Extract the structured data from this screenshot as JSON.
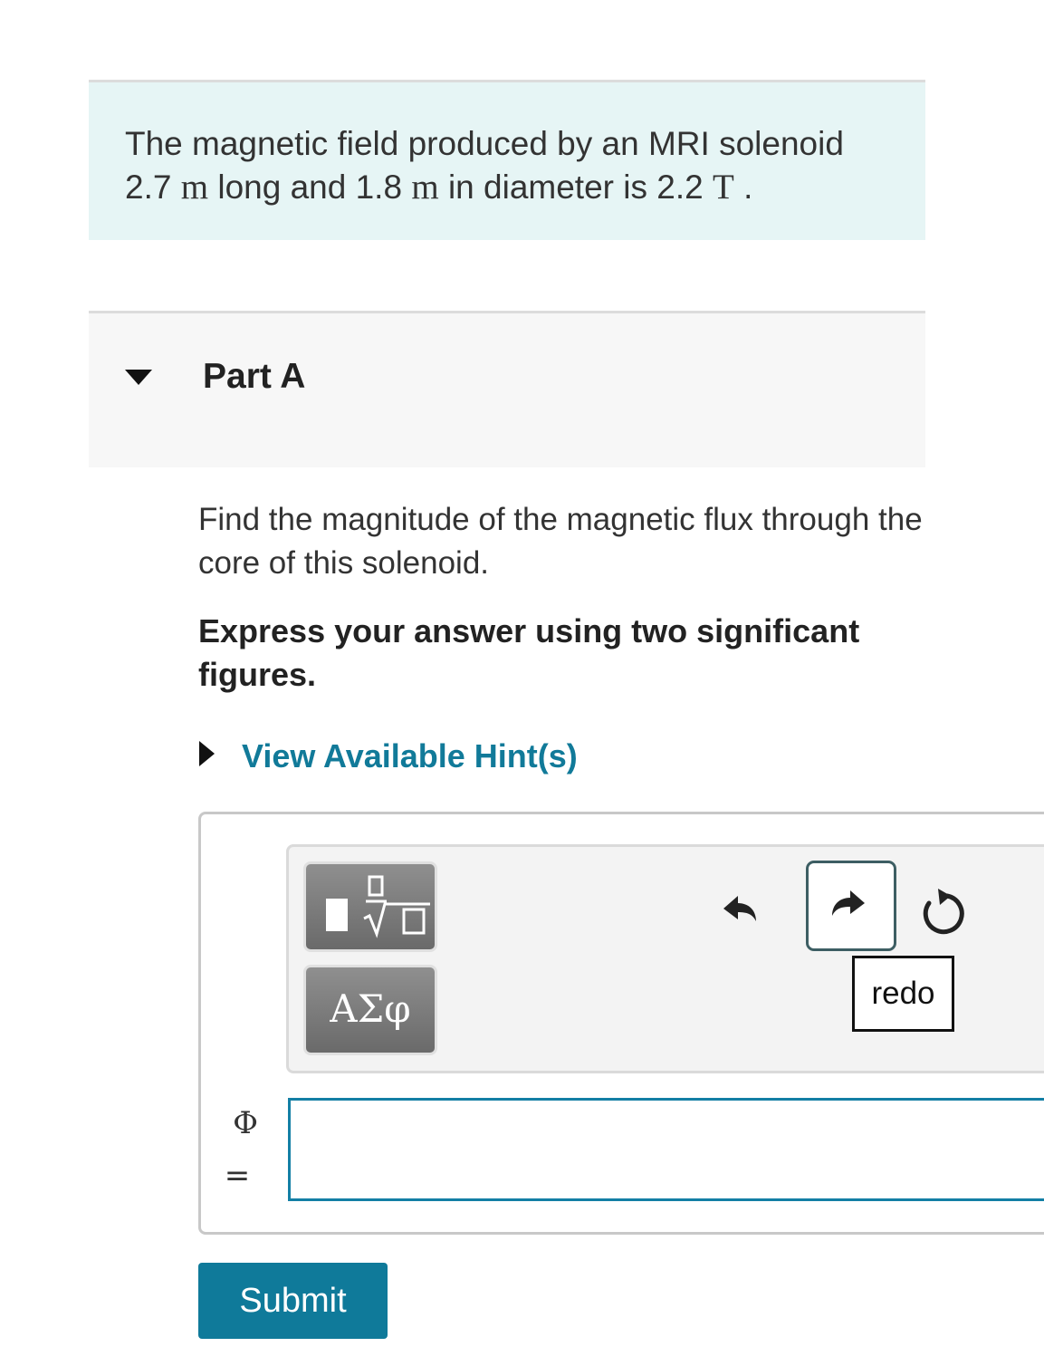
{
  "intro": {
    "text_1": "The magnetic field produced by an MRI solenoid",
    "length_value": "2.7",
    "length_unit": "m",
    "text_2": "long and",
    "diameter_value": "1.8",
    "diameter_unit": "m",
    "text_3": "in diameter is",
    "field_value": "2.2",
    "field_unit": "T",
    "text_end": "."
  },
  "part": {
    "title": "Part A",
    "question": "Find the magnitude of the magnetic flux through the core of this solenoid.",
    "instruction": "Express your answer using two significant figures.",
    "hint_link": "View Available Hint(s)"
  },
  "toolbar": {
    "greek_label": "ΑΣφ",
    "redo_tooltip": "redo"
  },
  "answer": {
    "variable": "Φ",
    "equals": "=",
    "value": ""
  },
  "submit_label": "Submit",
  "colors": {
    "intro_bg": "#e6f5f5",
    "link": "#117a99",
    "submit_bg": "#0f7a9a",
    "input_border": "#137fa5"
  }
}
